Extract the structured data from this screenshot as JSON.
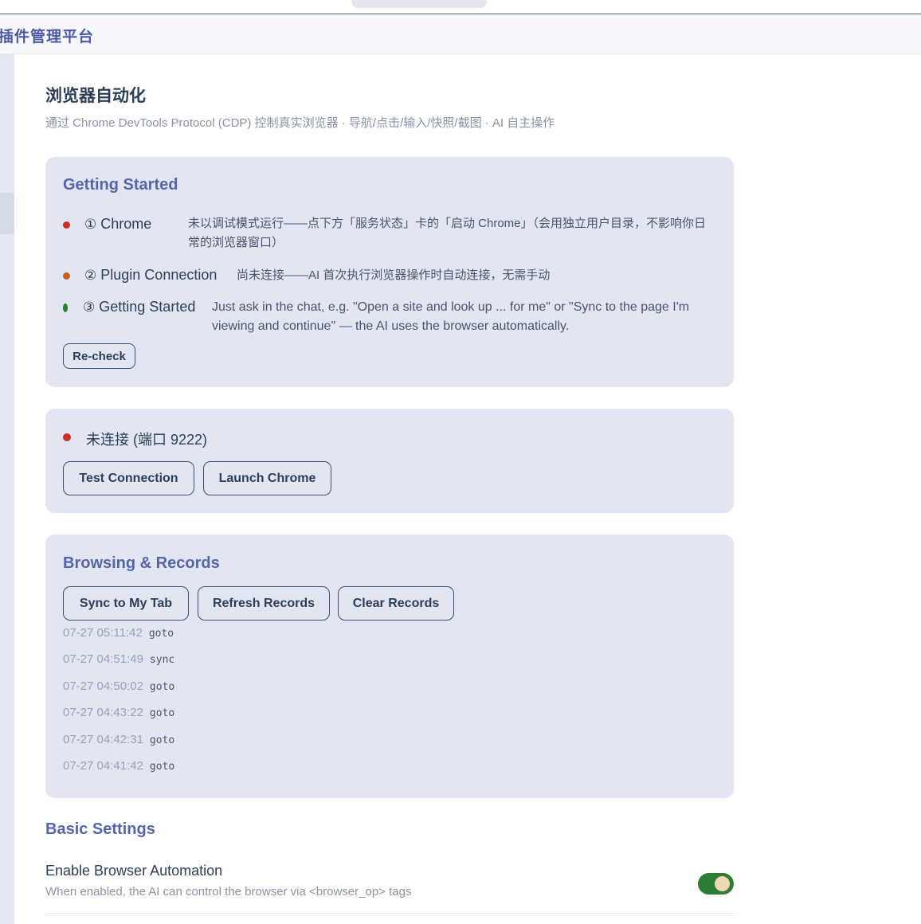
{
  "app": {
    "title": "插件管理平台"
  },
  "page": {
    "title": "浏览器自动化",
    "subtitle": "通过 Chrome DevTools Protocol (CDP) 控制真实浏览器 · 导航/点击/输入/快照/截图 · AI 自主操作"
  },
  "getting_started": {
    "title": "Getting Started",
    "steps": [
      {
        "num": "①",
        "name": "Chrome",
        "desc": "未以调试模式运行——点下方「服务状态」卡的「启动 Chrome」（会用独立用户目录，不影响你日常的浏览器窗口）",
        "color": "#c9302c"
      },
      {
        "num": "②",
        "name": "Plugin Connection",
        "desc": "尚未连接——AI 首次执行浏览器操作时自动连接，无需手动",
        "color": "#c8621d"
      },
      {
        "num": "③",
        "name": "Getting Started",
        "desc": "Just ask in the chat, e.g. \"Open a site and look up ... for me\" or \"Sync to the page I'm viewing and continue\" — the AI uses the browser automatically.",
        "color": "#2e7d32"
      }
    ],
    "recheck_label": "Re-check"
  },
  "service": {
    "status_text": "未连接 (端口 9222)",
    "status_color": "#c9302c",
    "test_label": "Test Connection",
    "launch_label": "Launch Chrome"
  },
  "records": {
    "title": "Browsing & Records",
    "sync_label": "Sync to My Tab",
    "refresh_label": "Refresh Records",
    "clear_label": "Clear Records",
    "items": [
      {
        "time": "07-27 05:11:42",
        "op": "goto"
      },
      {
        "time": "07-27 04:51:49",
        "op": "sync"
      },
      {
        "time": "07-27 04:50:02",
        "op": "goto"
      },
      {
        "time": "07-27 04:43:22",
        "op": "goto"
      },
      {
        "time": "07-27 04:42:31",
        "op": "goto"
      },
      {
        "time": "07-27 04:41:42",
        "op": "goto"
      }
    ]
  },
  "settings": {
    "title": "Basic Settings",
    "enable_label": "Enable Browser Automation",
    "enable_desc": "When enabled, the AI can control the browser via <browser_op> tags",
    "enabled": true
  }
}
